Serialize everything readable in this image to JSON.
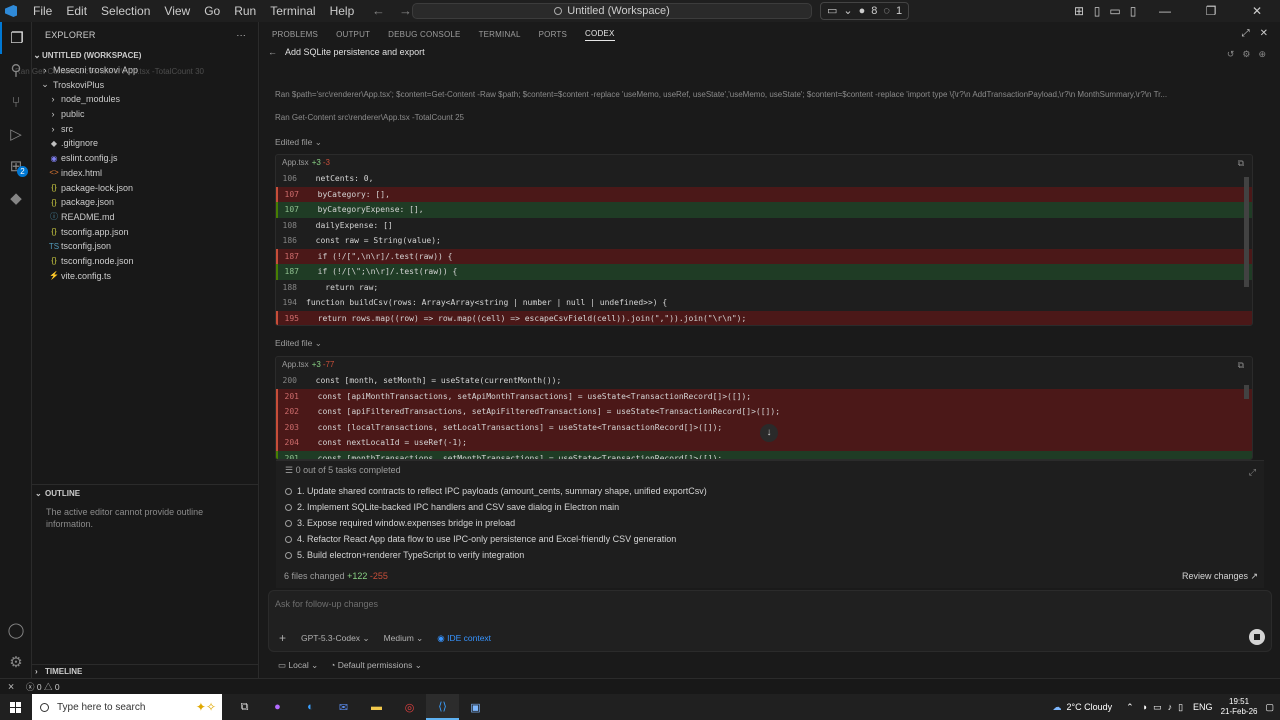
{
  "menu": [
    "File",
    "Edit",
    "Selection",
    "View",
    "Go",
    "Run",
    "Terminal",
    "Help"
  ],
  "titlebar": {
    "command_center": "Untitled (Workspace)",
    "copilot_count": "8",
    "sync_count": "1"
  },
  "sidebar": {
    "explorer_title": "EXPLORER",
    "workspace_title": "UNTITLED (WORKSPACE)",
    "tree": [
      {
        "label": "Mesecni troskovi App",
        "type": "folder",
        "depth": 1,
        "open": false
      },
      {
        "label": "TroskoviPlus",
        "type": "folder",
        "depth": 1,
        "open": true
      },
      {
        "label": "node_modules",
        "type": "folder",
        "depth": 2,
        "open": false
      },
      {
        "label": "public",
        "type": "folder",
        "depth": 2,
        "open": false
      },
      {
        "label": "src",
        "type": "folder",
        "depth": 2,
        "open": false
      },
      {
        "label": ".gitignore",
        "type": "file",
        "depth": 2,
        "icon": "gitignore-icon"
      },
      {
        "label": "eslint.config.js",
        "type": "file",
        "depth": 2,
        "icon": "eslint-icon"
      },
      {
        "label": "index.html",
        "type": "file",
        "depth": 2,
        "icon": "html-icon"
      },
      {
        "label": "package-lock.json",
        "type": "file",
        "depth": 2,
        "icon": "json-icon"
      },
      {
        "label": "package.json",
        "type": "file",
        "depth": 2,
        "icon": "json-icon"
      },
      {
        "label": "README.md",
        "type": "file",
        "depth": 2,
        "icon": "info-icon"
      },
      {
        "label": "tsconfig.app.json",
        "type": "file",
        "depth": 2,
        "icon": "json-icon"
      },
      {
        "label": "tsconfig.json",
        "type": "file",
        "depth": 2,
        "icon": "tsconfig-icon"
      },
      {
        "label": "tsconfig.node.json",
        "type": "file",
        "depth": 2,
        "icon": "json-icon"
      },
      {
        "label": "vite.config.ts",
        "type": "file",
        "depth": 2,
        "icon": "vite-icon"
      }
    ],
    "outline_title": "OUTLINE",
    "outline_message": "The active editor cannot provide outline information.",
    "timeline_title": "TIMELINE"
  },
  "panel": {
    "tabs": [
      "PROBLEMS",
      "OUTPUT",
      "DEBUG CONSOLE",
      "TERMINAL",
      "PORTS",
      "CODEX"
    ],
    "active_tab": "CODEX",
    "conversation_title": "Add SQLite persistence and export",
    "ran_commands": [
      "Ran Get-Content src\\renderer\\App.tsx -TotalCount 30",
      "Ran $path='src\\renderer\\App.tsx'; $content=Get-Content -Raw $path; $content=$content -replace 'useMemo, useRef, useState','useMemo, useState'; $content=$content -replace 'import type \\{\\r?\\n AddTransactionPayload,\\r?\\n MonthSummary,\\r?\\n Tr...",
      "Ran Get-Content src\\renderer\\App.tsx -TotalCount 25"
    ],
    "edited_label": "Edited file",
    "diffs": [
      {
        "file": "App.tsx",
        "added": "+3",
        "removed": "-3",
        "lines": [
          {
            "n": "106",
            "kind": "ctx",
            "code": "  netCents: 0,"
          },
          {
            "n": "107",
            "kind": "del",
            "code": "  byCategory: [],"
          },
          {
            "n": "107",
            "kind": "add",
            "code": "  byCategoryExpense: [],"
          },
          {
            "n": "108",
            "kind": "ctx",
            "code": "  dailyExpense: []"
          },
          {
            "n": "186",
            "kind": "ctx",
            "code": "  const raw = String(value);"
          },
          {
            "n": "187",
            "kind": "del",
            "code": "  if (!/[\",\\n\\r]/.test(raw)) {"
          },
          {
            "n": "187",
            "kind": "add",
            "code": "  if (!/[\\\";\\n\\r]/.test(raw)) {"
          },
          {
            "n": "188",
            "kind": "ctx",
            "code": "    return raw;"
          },
          {
            "n": "194",
            "kind": "ctx",
            "code": "function buildCsv(rows: Array<Array<string | number | null | undefined>>) {"
          },
          {
            "n": "195",
            "kind": "del",
            "code": "  return rows.map((row) => row.map((cell) => escapeCsvField(cell)).join(\",\")).join(\"\\r\\n\");"
          }
        ]
      },
      {
        "file": "App.tsx",
        "added": "+3",
        "removed": "-77",
        "lines": [
          {
            "n": "200",
            "kind": "ctx",
            "code": "  const [month, setMonth] = useState(currentMonth());"
          },
          {
            "n": "201",
            "kind": "del",
            "code": "  const [apiMonthTransactions, setApiMonthTransactions] = useState<TransactionRecord[]>([]);"
          },
          {
            "n": "202",
            "kind": "del",
            "code": "  const [apiFilteredTransactions, setApiFilteredTransactions] = useState<TransactionRecord[]>([]);"
          },
          {
            "n": "203",
            "kind": "del",
            "code": "  const [localTransactions, setLocalTransactions] = useState<TransactionRecord[]>([]);"
          },
          {
            "n": "204",
            "kind": "del",
            "code": "  const nextLocalId = useRef(-1);"
          },
          {
            "n": "201",
            "kind": "add",
            "code": "  const [monthTransactions, setMonthTransactions] = useState<TransactionRecord[]>([]);"
          }
        ]
      }
    ],
    "tasks_header": "0 out of 5 tasks completed",
    "tasks": [
      "1.  Update shared contracts to reflect IPC payloads (amount_cents, summary shape, unified exportCsv)",
      "2.  Implement SQLite-backed IPC handlers and CSV save dialog in Electron main",
      "3.  Expose required window.expenses bridge in preload",
      "4.  Refactor React App data flow to use IPC-only persistence and Excel-friendly CSV generation",
      "5.  Build electron+renderer TypeScript to verify integration"
    ],
    "files_changed": "6 files changed",
    "files_added": "+122",
    "files_removed": "-255",
    "review_changes": "Review changes ↗",
    "input_placeholder": "Ask for follow-up changes",
    "model": "GPT-5.3-Codex",
    "reasoning": "Medium",
    "ide_context": "IDE context",
    "env_local": "Local",
    "permissions": "Default permissions"
  },
  "statusbar": {
    "errors": "0",
    "warnings": "0"
  },
  "taskbar": {
    "search_placeholder": "Type here to search",
    "weather": "2°C  Cloudy",
    "lang": "ENG",
    "time": "19:51",
    "date": "21-Feb-26"
  },
  "colors": {
    "accent": "#0078d4",
    "added": "#89d185",
    "removed": "#c74e39"
  }
}
